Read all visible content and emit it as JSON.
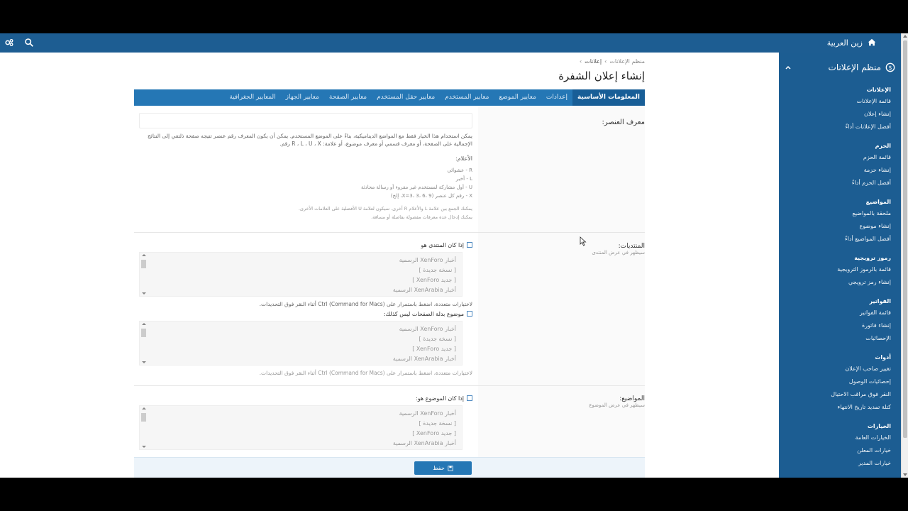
{
  "topbar": {
    "home_label": "زين العربية"
  },
  "sidebar": {
    "title": "منظم الإعلانات",
    "groups": [
      {
        "title": "الإعلانات",
        "items": [
          "قائمة الإعلانات",
          "إنشاء إعلان",
          "أفضل الإعلانات أداءً"
        ]
      },
      {
        "title": "الحزم",
        "items": [
          "قائمة الحزم",
          "إنشاء حزمة",
          "أفضل الحزم أداءً"
        ]
      },
      {
        "title": "المواضيع",
        "items": [
          "ملحقة بالمواضيع",
          "إنشاء موضوع",
          "أفضل المواضيع أداءً"
        ]
      },
      {
        "title": "رموز ترويجية",
        "items": [
          "قائمة بالرموز الترويجية",
          "إنشاء رمز ترويجي"
        ]
      },
      {
        "title": "الفواتير",
        "items": [
          "قائمة الفواتير",
          "إنشاء فاتورة",
          "الإحصائيات"
        ]
      },
      {
        "title": "أدوات",
        "items": [
          "تغيير صاحب الإعلان",
          "إحصائيات الوصول",
          "النقر فوق مراقب الاحتيال",
          "كتلة تمديد تاريخ الانتهاء"
        ]
      },
      {
        "title": "الخيارات",
        "items": [
          "الخيارات العامة",
          "خيارات المعلن",
          "خيارات المدير"
        ]
      }
    ]
  },
  "breadcrumb": {
    "root": "منظم الإعلانات",
    "current": "إعلانات"
  },
  "page_title": "إنشاء إعلان الشفرة",
  "tabs": [
    "المعلومات الأساسية",
    "إعدادات",
    "معايير الموضع",
    "معايير المستخدم",
    "معايير حقل المستخدم",
    "معايير الصفحة",
    "معايير الجهاز",
    "المعايير الجغرافية"
  ],
  "element_id": {
    "label": "معرف العنصر:",
    "explain": "يمكن استخدام هذا الخيار فقط مع المواضع الديناميكية، بناءً على الموضع المستخدم. يمكن أن يكون المعرف رقم عنصر تتيجه صفحة ذلتفي إلى النتائج الإجمالية على الصفحة، أو معرف قسمي أو معرف موضوع، أو علامة: R ، L ، U ، X رقم.",
    "flags_title": "الأعلام:",
    "flags": [
      "R - عشوائي",
      "L - أخير",
      "U - أول مشاركة لمستخدم غير مقروء أو رسالة محادثة",
      "X - رقم كل عنصر (X=3، 3، 6، 9، إلخ)"
    ],
    "note1": "يمكنك الجمع بين علامة L والأعلام R أخرى. سيكون لعلامة U الأفضلية على العلامات الأخرى.",
    "note2": "يمكنك إدخال عدة معرفات مفصولة بفاصلة أو مسافة."
  },
  "forums": {
    "label": "المنتديات:",
    "hint": "سيظهر في عرض المنتدى",
    "checkbox1": "إذا كان المنتدى هو",
    "checkbox2": "موضوع بدلة الصفحات ليس كذلك:",
    "options": [
      "أخبار XenForo الرسمية",
      "[ نسخة جديدة ]",
      "[ جديد XenForo ]",
      "أخبار XenArabia الرسمية"
    ],
    "multi_hint": "لاختيارات متعددة، اضغط باستمرار على Ctrl (Command for Macs) أثناء النقر فوق التحديدات."
  },
  "threads": {
    "label": "المواضيع:",
    "hint": "سيظهر في عرض الموضوع",
    "checkbox1": "إذا كان الموضوع هو:",
    "options": [
      "أخبار XenForo الرسمية",
      "[ نسخة جديدة ]",
      "[ جديد XenForo ]",
      "أخبار XenArabia الرسمية"
    ]
  },
  "save_label": "حفظ",
  "colors": {
    "primary": "#2577b5",
    "header": "#1d5d92"
  }
}
